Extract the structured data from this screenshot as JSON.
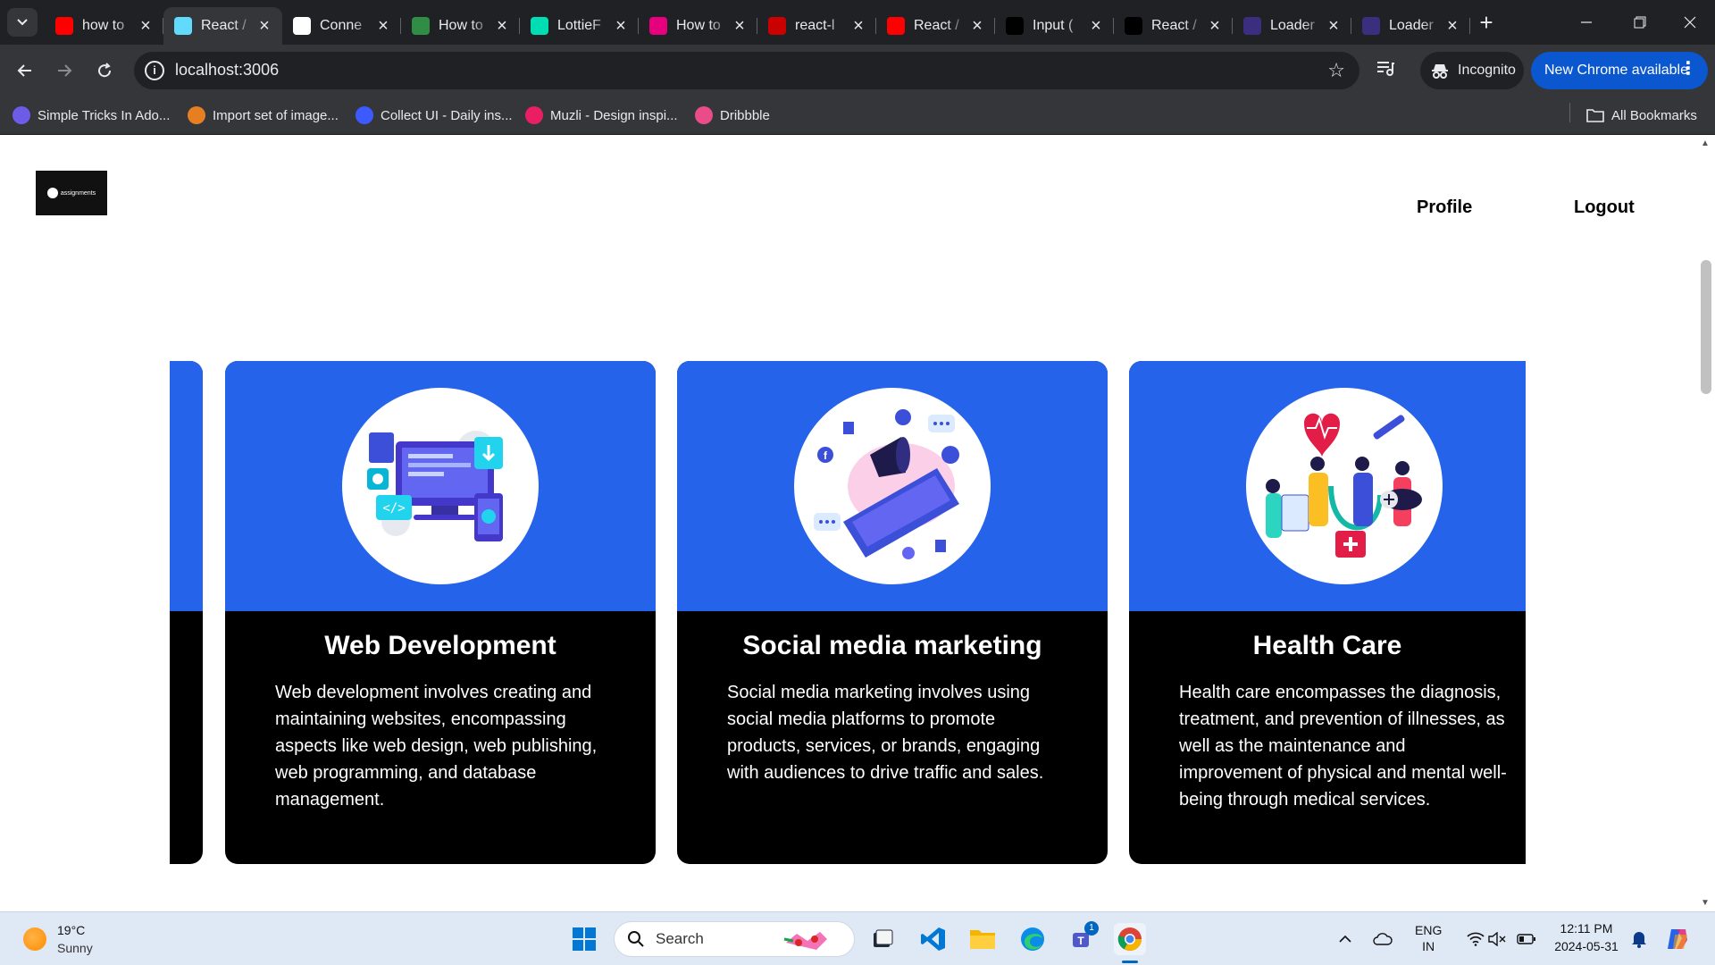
{
  "browser": {
    "tabs": [
      {
        "title": "how to",
        "favicon": "youtube-icon",
        "color": "#ff0000"
      },
      {
        "title": "React /",
        "favicon": "react-icon",
        "color": "#61dafb",
        "active": true
      },
      {
        "title": "Conne",
        "favicon": "openai-icon",
        "color": "#ffffff"
      },
      {
        "title": "How to",
        "favicon": "geeksforgeeks-icon",
        "color": "#2f8d46"
      },
      {
        "title": "LottieF",
        "favicon": "lottiefiles-icon",
        "color": "#00ddb3"
      },
      {
        "title": "How to",
        "favicon": "tutorial-icon",
        "color": "#e6007e"
      },
      {
        "title": "react-l",
        "favicon": "npm-icon",
        "color": "#cb0000"
      },
      {
        "title": "React /",
        "favicon": "youtube-icon",
        "color": "#ff0000"
      },
      {
        "title": "Input (",
        "favicon": "shadcn-icon",
        "color": "#000000"
      },
      {
        "title": "React /",
        "favicon": "medium-icon",
        "color": "#000000"
      },
      {
        "title": "Loader",
        "favicon": "uiverse-icon",
        "color": "#3b2e7e"
      },
      {
        "title": "Loader",
        "favicon": "uiverse-icon",
        "color": "#3b2e7e"
      }
    ],
    "url": "localhost:3006",
    "incognito_label": "Incognito",
    "update_label": "New Chrome available",
    "bookmarks": [
      {
        "label": "Simple Tricks In Ado...",
        "favicon": "bookmark-favicon-1",
        "color": "#6c5ce7"
      },
      {
        "label": "Import set of image...",
        "favicon": "bookmark-favicon-2",
        "color": "#e67e22"
      },
      {
        "label": "Collect UI - Daily ins...",
        "favicon": "bookmark-favicon-3",
        "color": "#3d5afe"
      },
      {
        "label": "Muzli - Design inspi...",
        "favicon": "bookmark-favicon-4",
        "color": "#e91e63"
      },
      {
        "label": "Dribbble",
        "favicon": "dribbble-icon",
        "color": "#ea4c89"
      }
    ],
    "all_bookmarks_label": "All Bookmarks"
  },
  "page": {
    "logo_text": "assignments",
    "nav": {
      "profile": "Profile",
      "logout": "Logout"
    },
    "cards": [
      {
        "title": "Web Development",
        "description": "Web development involves creating and maintaining websites, encompassing aspects like web design, web publishing, web programming, and database management.",
        "illustration": "web-development-illustration"
      },
      {
        "title": "Social media marketing",
        "description": "Social media marketing involves using social media platforms to promote products, services, or brands, engaging with audiences to drive traffic and sales.",
        "illustration": "social-media-illustration"
      },
      {
        "title": "Health Care",
        "description": "Health care encompasses the diagnosis, treatment, and prevention of illnesses, as well as the maintenance and improvement of physical and mental well-being through medical services.",
        "illustration": "health-care-illustration"
      }
    ],
    "colors": {
      "card_top": "#2563eb",
      "card_bottom": "#000000"
    }
  },
  "taskbar": {
    "weather": {
      "temp": "19°C",
      "condition": "Sunny"
    },
    "search_placeholder": "Search",
    "lang": {
      "line1": "ENG",
      "line2": "IN"
    },
    "clock": {
      "time": "12:11 PM",
      "date": "2024-05-31"
    },
    "teams_badge": "1"
  }
}
